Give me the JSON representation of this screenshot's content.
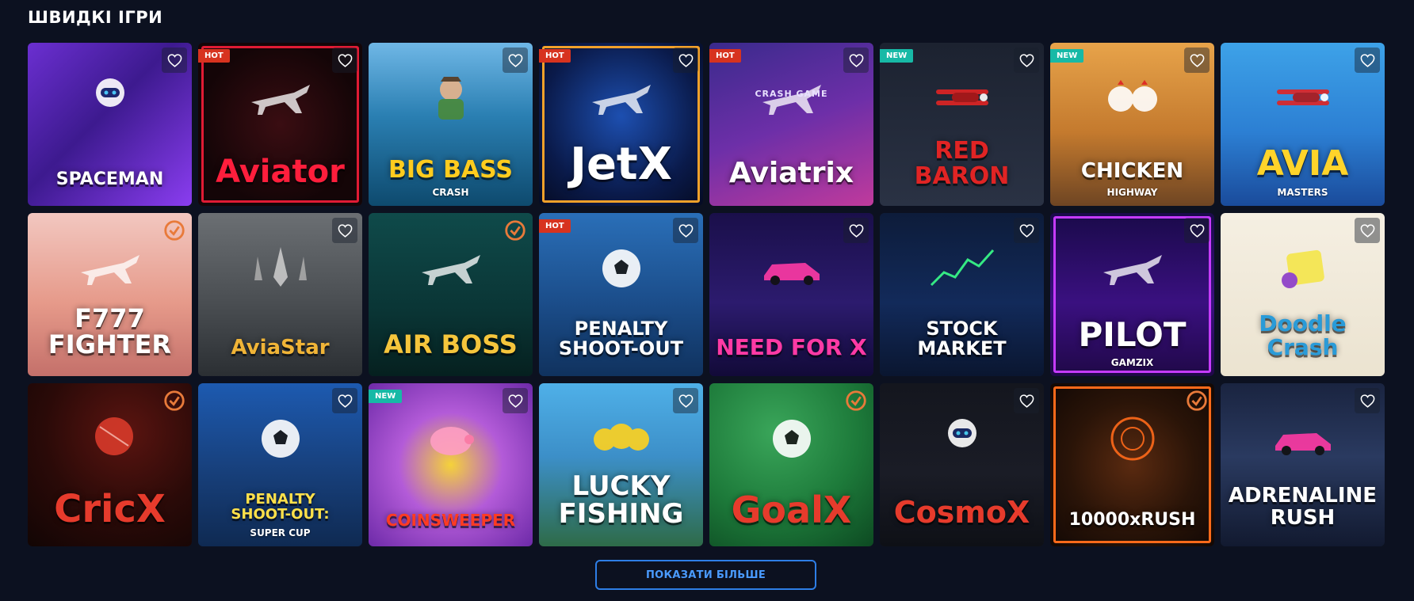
{
  "section": {
    "title": "ШВИДКІ ІГРИ"
  },
  "games": [
    {
      "title": "SPACEMAN",
      "badge": "",
      "bg": "linear-gradient(135deg,#6b2fd1 0%,#3d1a8f 45%,#8a3df0 100%)",
      "title_color": "#ffffff",
      "font_size": 22,
      "icon": "astronaut-icon"
    },
    {
      "title": "Aviator",
      "badge": "HOT",
      "bg": "radial-gradient(circle at 50% 50%,#3a0d12 0%,#140507 70%)",
      "title_color": "#ff1e3c",
      "font_size": 40,
      "icon": "plane-icon",
      "border": "#e01b34"
    },
    {
      "title": "BIG BASS",
      "subtitle": "CRASH",
      "badge": "",
      "bg": "linear-gradient(180deg,#6fb7e6 0%,#2a7fb2 45%,#0e4a6e 100%)",
      "title_color": "#ffcc1e",
      "font_size": 30,
      "icon": "fisherman-icon"
    },
    {
      "title": "JetX",
      "badge": "HOT",
      "bg": "radial-gradient(circle at 50% 45%,#1d4fb0 0%,#0a1a4a 65%,#050b22 100%)",
      "title_color": "#ffffff",
      "font_size": 56,
      "icon": "jet-icon",
      "border": "#f2a12a"
    },
    {
      "title": "Aviatrix",
      "top_tag": "CRASH GAME",
      "badge": "HOT",
      "bg": "linear-gradient(160deg,#3a2a8c 0%,#6d2fa8 50%,#c03a9c 100%)",
      "title_color": "#ffffff",
      "font_size": 36,
      "icon": "plane-icon"
    },
    {
      "title": "RED\nBARON",
      "badge": "NEW",
      "bg": "linear-gradient(180deg,#1c2230 0%,#2a3244 100%)",
      "title_color": "#e02424",
      "font_size": 30,
      "icon": "biplane-icon"
    },
    {
      "title": "CHICKEN",
      "subtitle": "HIGHWAY",
      "badge": "NEW",
      "bg": "linear-gradient(180deg,#e7a34a 0%,#c47a2e 55%,#6e4523 100%)",
      "title_color": "#ffffff",
      "font_size": 26,
      "icon": "chicken-icon"
    },
    {
      "title": "AVIA",
      "subtitle": "MASTERS",
      "badge": "",
      "bg": "linear-gradient(180deg,#3da2e8 0%,#2c7fd3 55%,#1a4b9b 100%)",
      "title_color": "#ffd42a",
      "font_size": 44,
      "icon": "biplane-icon"
    },
    {
      "title": "F777\nFIGHTER",
      "badge": "",
      "bg": "linear-gradient(180deg,#f2c7c0 0%,#e69a8a 55%,#c4706a 100%)",
      "title_color": "#ffffff",
      "font_size": 32,
      "icon": "jet-icon",
      "provider": true
    },
    {
      "title": "AviaStar",
      "badge": "",
      "bg": "linear-gradient(180deg,#6b6f73 0%,#4a4e52 55%,#2b2f33 100%)",
      "title_color": "#f0b437",
      "font_size": 26,
      "icon": "spaceship-icon"
    },
    {
      "title": "AIR BOSS",
      "badge": "",
      "bg": "linear-gradient(180deg,#0f4a4a 0%,#0a3535 60%,#05201f 100%)",
      "title_color": "#f5c53c",
      "font_size": 32,
      "icon": "jet-icon",
      "provider": true
    },
    {
      "title": "PENALTY\nSHOOT-OUT",
      "badge": "HOT",
      "bg": "linear-gradient(180deg,#2a6fb8 0%,#1b4d8a 55%,#10325e 100%)",
      "title_color": "#ffffff",
      "font_size": 24,
      "icon": "ball-icon"
    },
    {
      "title": "NEED FOR X",
      "badge": "",
      "bg": "linear-gradient(180deg,#1a0f4a 0%,#2c1b6e 55%,#120a38 100%)",
      "title_color": "#ff3aa5",
      "font_size": 28,
      "icon": "car-icon"
    },
    {
      "title": "STOCK\nMARKET",
      "badge": "",
      "bg": "linear-gradient(180deg,#0d1c3a 0%,#122a5a 55%,#0a1630 100%)",
      "title_color": "#ffffff",
      "font_size": 24,
      "icon": "chart-icon"
    },
    {
      "title": "PILOT",
      "subtitle": "GAMZIX",
      "badge": "",
      "bg": "linear-gradient(180deg,#1a0a4a 0%,#3a1080 55%,#200848 100%)",
      "title_color": "#ffffff",
      "font_size": 42,
      "icon": "plane-icon",
      "border": "#c63bff"
    },
    {
      "title": "Doodle\nCrash",
      "badge": "",
      "bg": "linear-gradient(180deg,#f5efe2 0%,#ebe3d0 100%)",
      "title_color": "#2a9bd8",
      "font_size": 28,
      "icon": "monster-icon"
    },
    {
      "title": "CricX",
      "badge": "",
      "bg": "radial-gradient(circle at 60% 30%,#5a1410 0%,#2a0a08 55%,#120504 100%)",
      "title_color": "#e63b2c",
      "font_size": 48,
      "icon": "cricket-ball-icon",
      "provider": true
    },
    {
      "title": "PENALTY\nSHOOT-OUT:",
      "subtitle": "SUPER CUP",
      "badge": "",
      "bg": "linear-gradient(180deg,#1d5ab0 0%,#173f7a 55%,#0f2a52 100%)",
      "title_color": "#ffe04a",
      "font_size": 18,
      "icon": "ball-icon"
    },
    {
      "title": "COINSWEEPER",
      "badge": "NEW",
      "bg": "radial-gradient(circle at 50% 50%,#f5d23a 0%,#b35bd8 45%,#6d2aa8 100%)",
      "title_color": "#ff3b22",
      "font_size": 20,
      "icon": "piggy-bank-icon"
    },
    {
      "title": "LUCKY\nFISHING",
      "badge": "",
      "bg": "linear-gradient(180deg,#4fb0e8 0%,#3c8fc8 45%,#2e6b48 100%)",
      "title_color": "#ffffff",
      "font_size": 34,
      "icon": "duck-icon"
    },
    {
      "title": "GoalX",
      "badge": "",
      "bg": "radial-gradient(circle at 40% 30%,#3aa65a 0%,#1d7a3a 55%,#0d4a22 100%)",
      "title_color": "#e63b2c",
      "font_size": 46,
      "icon": "football-icon",
      "provider": true
    },
    {
      "title": "CosmoX",
      "badge": "",
      "bg": "linear-gradient(180deg,#14161e 0%,#1a1c26 55%,#0e1016 100%)",
      "title_color": "#e63b2c",
      "font_size": 38,
      "icon": "astronaut-icon"
    },
    {
      "title": "10000xRUSH",
      "badge": "",
      "bg": "radial-gradient(circle at 50% 50%,#5a2a10 0%,#2a1408 55%,#120804 100%)",
      "title_color": "#ffffff",
      "font_size": 22,
      "icon": "radar-icon",
      "border": "#ff6a1a",
      "provider": true
    },
    {
      "title": "ADRENALINE\nRUSH",
      "badge": "",
      "bg": "linear-gradient(180deg,#1a2440 0%,#2a3a60 45%,#121a30 100%)",
      "title_color": "#ffffff",
      "font_size": 26,
      "icon": "car-icon"
    }
  ],
  "show_more": {
    "label": "ПОКАЗАТИ БІЛЬШЕ"
  }
}
